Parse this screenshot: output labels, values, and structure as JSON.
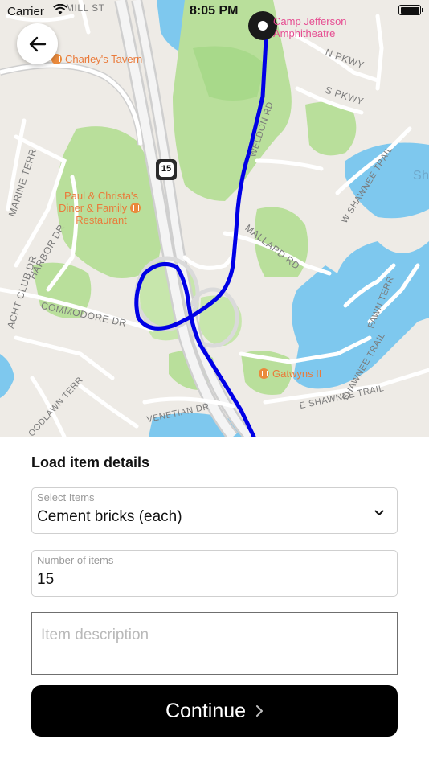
{
  "status_bar": {
    "carrier": "Carrier",
    "time": "8:05 PM"
  },
  "map": {
    "road_labels": {
      "mill_st": "MILL ST",
      "n_pkwy": "N PKWY",
      "s_pkwy": "S PKWY",
      "weldon_rd": "WELDON RD",
      "w_shawnee_trail": "W SHAWNEE TRAIL",
      "mallard_rd": "MALLARD RD",
      "harbor_dr": "HARBOR DR",
      "marine_terr": "MARINE TERR",
      "acht_club_dr": "ACHT CLUB DR",
      "commodore_dr": "COMMODORE DR",
      "fawn_terr": "FAWN TERR",
      "e_shawnee_trail": "E SHAWNEE TRAIL",
      "shawnee_trail": "SHAWNEE TRAIL",
      "venetian_dr": "VENETIAN DR",
      "oodlawn_terr": "OODLAWN TERR",
      "edge_sh": "Sh",
      "edge_s": "S"
    },
    "route_shield": "15",
    "poi": {
      "charleys": "Charley's Tavern",
      "paul_christa_1": "Paul & Christa's",
      "paul_christa_2": "Diner & Family",
      "paul_christa_3": "Restaurant",
      "camp_jefferson_1": "Camp Jefferson",
      "camp_jefferson_2": "Amphitheatre",
      "gatwyns": "Gatwyns II"
    },
    "colors": {
      "route": "#0000e6",
      "water": "#7ec8ee",
      "park": "#b9df9b",
      "land": "#eeebe6",
      "road": "#ffffff"
    }
  },
  "form": {
    "title": "Load item details",
    "select_items": {
      "label": "Select Items",
      "value": "Cement bricks (each)"
    },
    "number_of_items": {
      "label": "Number of items",
      "value": "15"
    },
    "description": {
      "placeholder": "Item description"
    },
    "continue_label": "Continue"
  },
  "icons": {
    "back": "arrow-left-icon",
    "wifi": "wifi-icon",
    "battery": "battery-icon",
    "dropdown": "chevron-down-icon",
    "continue": "chevron-right-icon",
    "destination": "destination-pin-icon"
  }
}
